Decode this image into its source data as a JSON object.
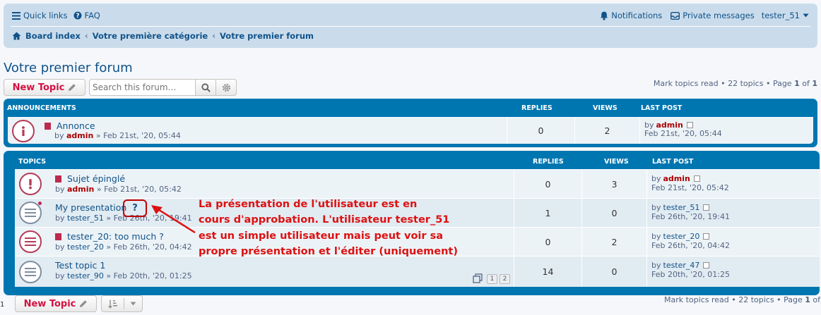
{
  "nav": {
    "quick_links": "Quick links",
    "faq": "FAQ",
    "notifications": "Notifications",
    "private_messages": "Private messages",
    "username": "tester_51"
  },
  "breadcrumb": {
    "board_index": "Board index",
    "category": "Votre première catégorie",
    "forum": "Votre premier forum"
  },
  "page": {
    "title": "Votre premier forum",
    "new_topic": "New Topic",
    "search_placeholder": "Search this forum…",
    "pagination_top": {
      "mark": "Mark topics read",
      "sep": " • ",
      "count": "22 topics",
      "page_label": "Page ",
      "current": "1",
      "of": " of ",
      "total": "1"
    },
    "pagination_bottom": {
      "mark": "Mark topics read",
      "sep": " • ",
      "count": "22 topics",
      "page_label": "Page ",
      "current": "1",
      "of": " of"
    },
    "stray_left": "1"
  },
  "announcements": {
    "header": "ANNOUNCEMENTS",
    "replies_h": "REPLIES",
    "views_h": "VIEWS",
    "last_h": "LAST POST",
    "rows": [
      {
        "title": "Annonce",
        "by": "by",
        "author": "admin",
        "meta": " » Feb 21st, '20, 05:44",
        "replies": "0",
        "views": "2",
        "last_by": "by",
        "last_author": "admin",
        "last_date": "Feb 21st, '20, 05:44"
      }
    ]
  },
  "topics": {
    "header": "TOPICS",
    "replies_h": "REPLIES",
    "views_h": "VIEWS",
    "last_h": "LAST POST",
    "rows": [
      {
        "title": "Sujet épinglé",
        "by": "by",
        "author": "admin",
        "meta": " » Feb 21st, '20, 05:42",
        "replies": "0",
        "views": "3",
        "last_by": "by",
        "last_author": "admin",
        "last_date": "Feb 21st, '20, 05:42"
      },
      {
        "title": "My presentation",
        "by": "by",
        "author": "tester_51",
        "meta": " » Feb 26th, '20, 19:41",
        "replies": "1",
        "views": "0",
        "last_by": "by",
        "last_author": "tester_51",
        "last_date": "Feb 26th, '20, 19:41"
      },
      {
        "title": "tester_20: too much ?",
        "by": "by",
        "author": "tester_20",
        "meta": " » Feb 26th, '20, 04:42",
        "replies": "0",
        "views": "2",
        "last_by": "by",
        "last_author": "tester_20",
        "last_date": "Feb 26th, '20, 04:42"
      },
      {
        "title": "Test topic 1",
        "by": "by",
        "author": "tester_90",
        "meta": " » Feb 20th, '20, 01:25",
        "replies": "14",
        "views": "0",
        "last_by": "by",
        "last_author": "tester_47",
        "last_date": "Feb 20th, '20, 01:25",
        "pages": [
          "1",
          "2"
        ]
      }
    ]
  },
  "annotation": {
    "qmark": "?",
    "lines": [
      "La présentation de l'utilisateur est en",
      "cours d'approbation. L'utilisateur tester_51",
      "est un simple utilisateur mais peut voir sa",
      "propre présentation et l'éditer (uniquement)"
    ]
  },
  "colors": {
    "accent": "#0076b1",
    "brand_red": "#d31141",
    "link": "#105289",
    "annotation": "#dd1111"
  }
}
